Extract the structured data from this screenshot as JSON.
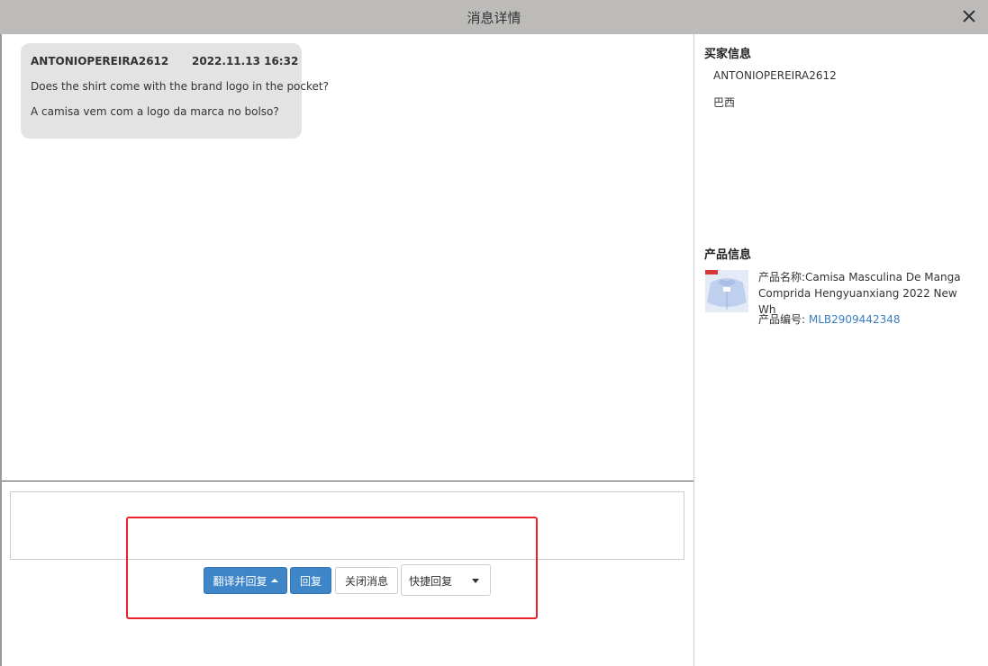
{
  "window": {
    "title": "消息详情",
    "close_icon": "close-icon"
  },
  "message": {
    "sender": "ANTONIOPEREIRA2612",
    "timestamp": "2022.11.13 16:32",
    "text_original": "Does the shirt come with the brand logo in the pocket?",
    "text_translated": "A camisa vem com a logo da marca no bolso?"
  },
  "reply": {
    "value": "",
    "placeholder": ""
  },
  "actions": {
    "translate_reply_label": "翻译并回复",
    "reply_label": "回复",
    "close_message_label": "关闭消息",
    "quick_reply_label": "快捷回复"
  },
  "buyer": {
    "heading": "买家信息",
    "name": "ANTONIOPEREIRA2612",
    "country": "巴西"
  },
  "product": {
    "heading": "产品信息",
    "name_label": "产品名称:",
    "name_value": "Camisa Masculina De Manga Comprida Hengyuanxiang 2022 New Wh",
    "sku_label": "产品编号: ",
    "sku_value": "MLB2909442348",
    "thumbnail_icon": "shirt-image"
  },
  "colors": {
    "titlebar": "#bcbbb9",
    "primary": "#3e86c8",
    "highlight": "#e8232b",
    "link": "#3a7fc1",
    "bubble": "#e3e3e3"
  }
}
